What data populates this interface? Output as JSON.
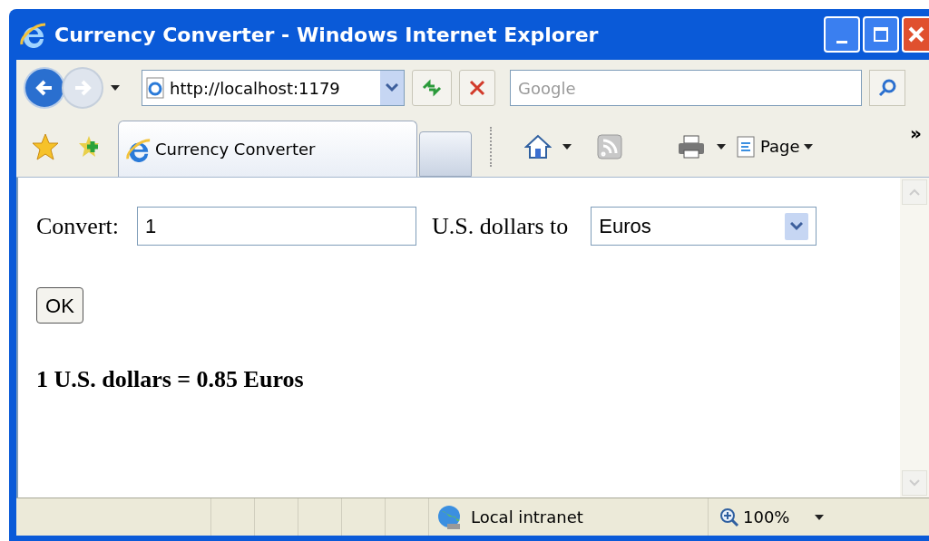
{
  "window": {
    "title": "Currency Converter - Windows Internet Explorer"
  },
  "navigation": {
    "address": "http://localhost:1179",
    "search_placeholder": "Google"
  },
  "tabs": [
    {
      "label": "Currency Converter",
      "selected": true
    }
  ],
  "command_bar": {
    "page_button": "Page",
    "more": "»"
  },
  "form": {
    "convert_label": "Convert:",
    "amount": "1",
    "units_label": "U.S. dollars to",
    "currency": "Euros",
    "ok_button": "OK",
    "result": "1 U.S. dollars = 0.85 Euros"
  },
  "status_bar": {
    "zone": "Local intranet",
    "zoom": "100%"
  }
}
